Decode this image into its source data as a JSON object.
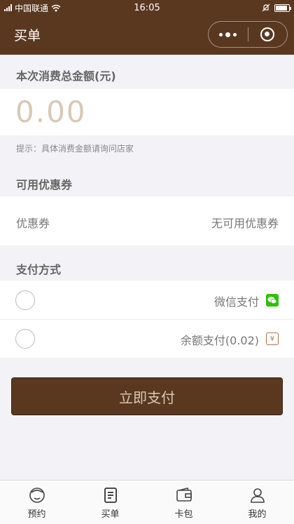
{
  "status_bar": {
    "carrier": "中国联通",
    "time": "16:05",
    "battery_level": 0.9
  },
  "header": {
    "title": "买单"
  },
  "amount_section": {
    "title": "本次消费总金额(元)",
    "value": "0.00",
    "tip": "提示：具体消费金额请询问店家"
  },
  "coupon_section": {
    "title": "可用优惠券",
    "label": "优惠券",
    "value": "无可用优惠券"
  },
  "payment_section": {
    "title": "支付方式",
    "methods": [
      {
        "label": "微信支付",
        "icon": "wechat-icon",
        "selected": false
      },
      {
        "label": "余额支付(0.02)",
        "icon": "wallet-icon",
        "selected": false
      }
    ]
  },
  "pay_button": {
    "label": "立即支付"
  },
  "tabbar": {
    "items": [
      {
        "label": "预约",
        "icon": "reservation-icon",
        "active": false
      },
      {
        "label": "买单",
        "icon": "bill-icon",
        "active": true
      },
      {
        "label": "卡包",
        "icon": "card-wallet-icon",
        "active": false
      },
      {
        "label": "我的",
        "icon": "profile-icon",
        "active": false
      }
    ]
  },
  "colors": {
    "brand": "#5a3820",
    "amount_text": "#d8c8b5",
    "wechat_green": "#2dc100",
    "background": "#f3f2f6"
  }
}
